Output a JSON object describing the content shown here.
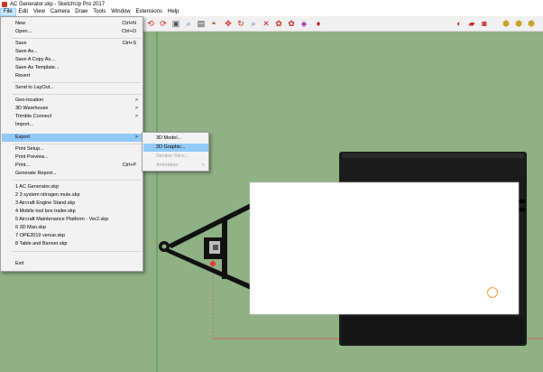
{
  "window": {
    "title": "AC Generator.skp - SketchUp Pro 2017"
  },
  "menubar": [
    "File",
    "Edit",
    "View",
    "Camera",
    "Draw",
    "Tools",
    "Window",
    "Extensions",
    "Help"
  ],
  "file_menu": {
    "new": {
      "label": "New",
      "shortcut": "Ctrl+N"
    },
    "open": {
      "label": "Open...",
      "shortcut": "Ctrl+O"
    },
    "save": {
      "label": "Save",
      "shortcut": "Ctrl+S"
    },
    "save_as": {
      "label": "Save As..."
    },
    "save_copy_as": {
      "label": "Save A Copy As..."
    },
    "save_as_template": {
      "label": "Save As Template..."
    },
    "revert": {
      "label": "Revert"
    },
    "send_to_layout": {
      "label": "Send to LayOut..."
    },
    "geo_location": {
      "label": "Geo-location"
    },
    "warehouse": {
      "label": "3D Warehouse"
    },
    "trimble_connect": {
      "label": "Trimble Connect"
    },
    "import": {
      "label": "Import..."
    },
    "export": {
      "label": "Export"
    },
    "print_setup": {
      "label": "Print Setup..."
    },
    "print_preview": {
      "label": "Print Preview..."
    },
    "print": {
      "label": "Print...",
      "shortcut": "Ctrl+P"
    },
    "generate_report": {
      "label": "Generate Report..."
    },
    "recent": [
      "1 AC Generator.skp",
      "2 3 system nitrogen mule.skp",
      "3 Aircraft Engine Stand.skp",
      "4 Mobile tool box trailer.skp",
      "5 Aircraft Maintenance Platform - Ver2.skp",
      "6 3D Man.skp",
      "7 OPE2019 venue.skp",
      "8 Table and Banner.skp"
    ],
    "exit": {
      "label": "Exit"
    },
    "submenu_arrow": ">"
  },
  "export_menu": {
    "model_3d": "3D Model...",
    "graphic_2d": "2D Graphic...",
    "section_slice": "Section Slice...",
    "animation": "Animation"
  },
  "icons": [
    "undo-icon",
    "redo-icon",
    "paint-icon",
    "search-icon",
    "text-icon",
    "paint-bucket-icon",
    "move-icon",
    "rotate-icon",
    "zoom-icon",
    "zoom-extents-icon",
    "component-icon",
    "material-icon",
    "style-icon",
    "ruby-icon",
    "extension-warehouse-icon",
    "layout-icon",
    "sketchup-red-icon",
    "iso-view-icon",
    "top-view-icon",
    "front-view-icon"
  ],
  "colors": {
    "canvas": "#8fb184",
    "highlight": "#91c9f7",
    "axis_green": "#3d8b3d",
    "axis_red": "#e05050"
  }
}
